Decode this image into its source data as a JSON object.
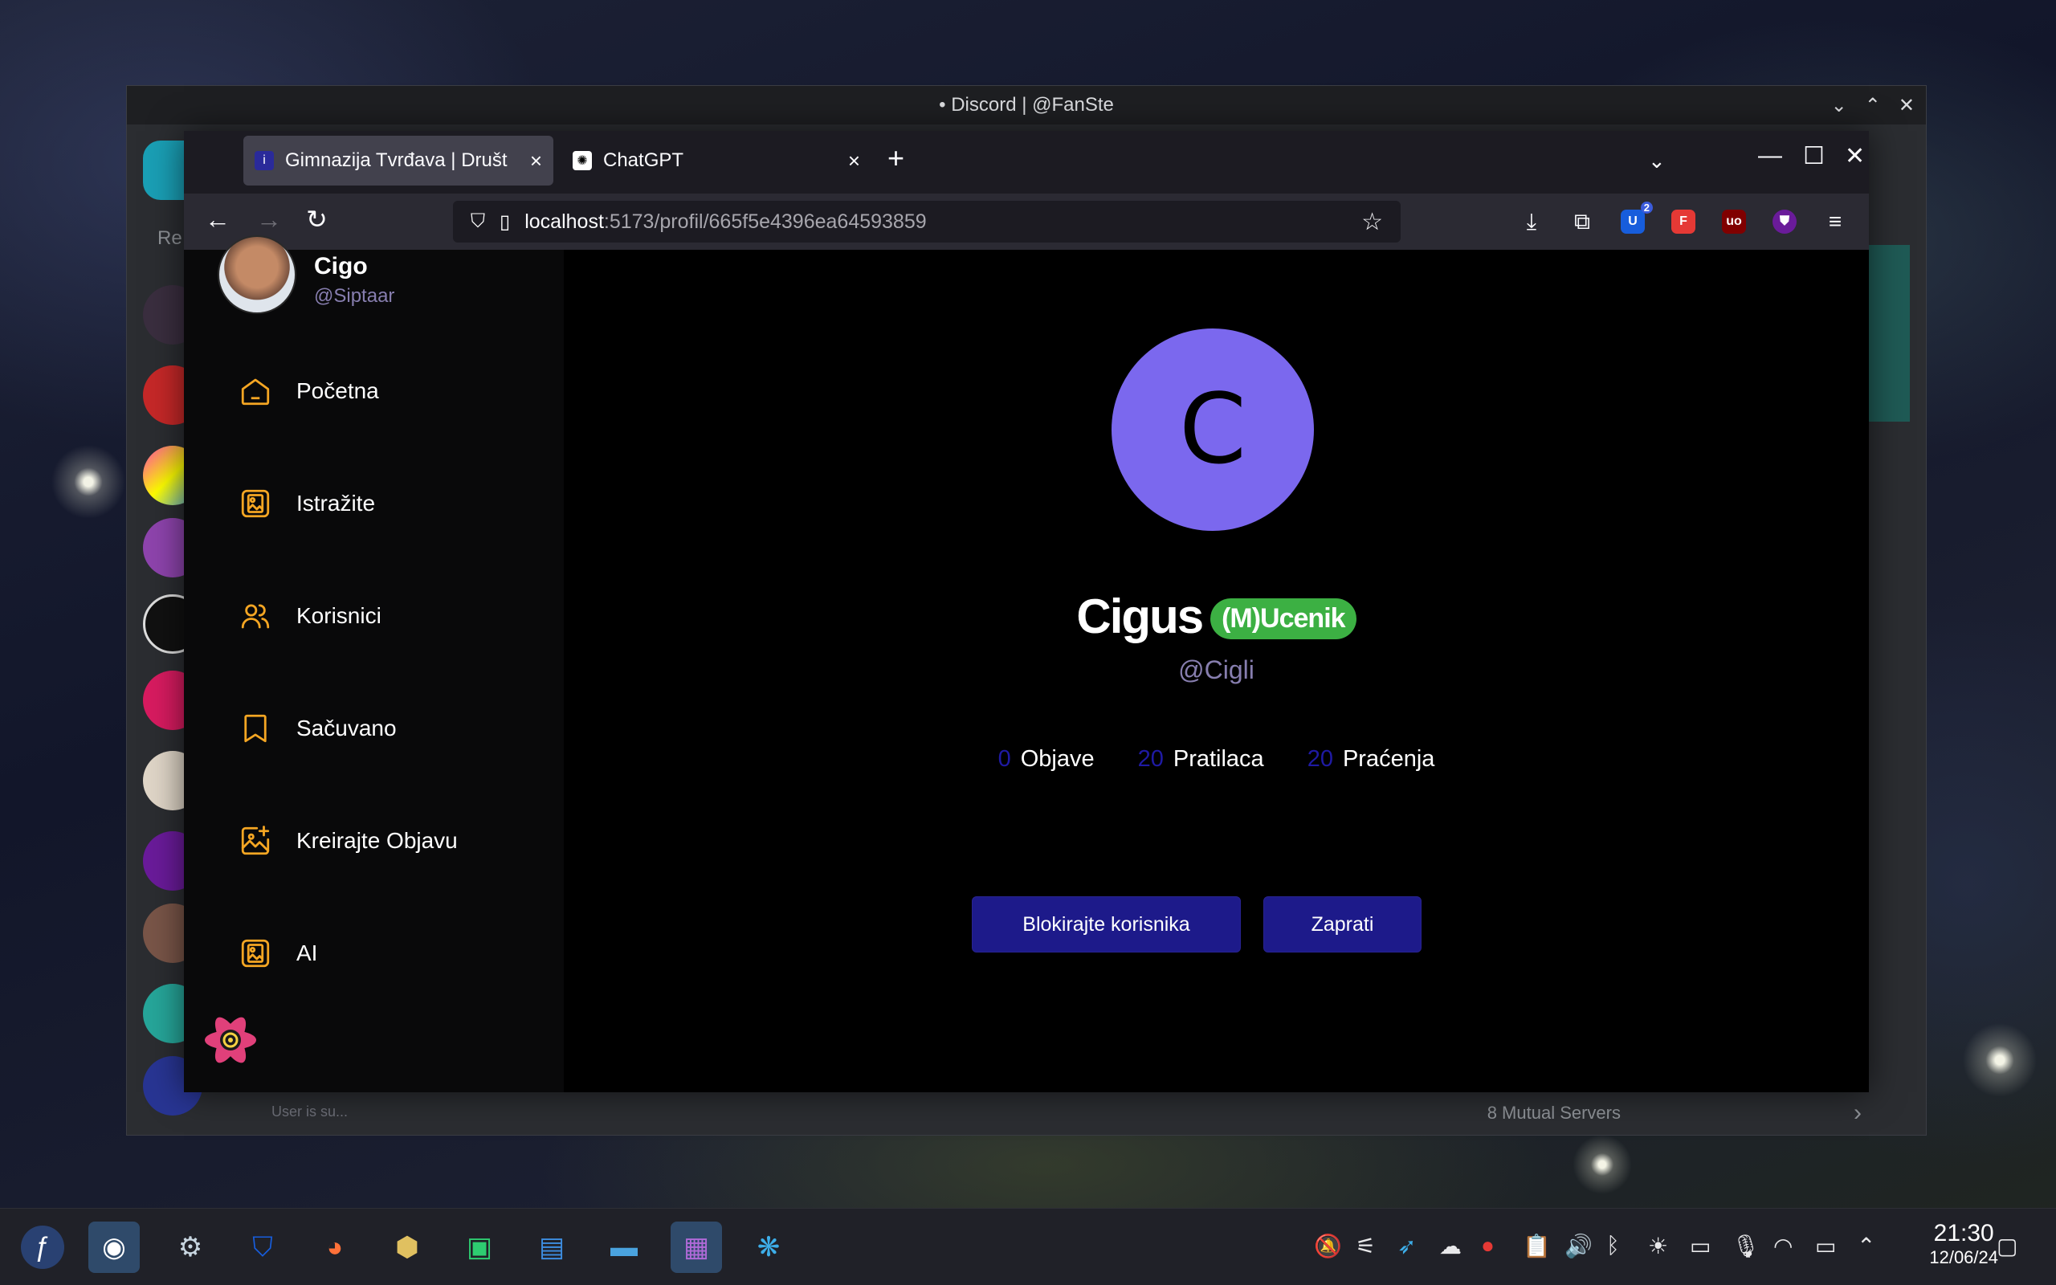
{
  "discord": {
    "title": "• Discord | @FanSte",
    "mutual_servers": "8 Mutual Servers",
    "user_status": "User is su...",
    "rail_label": "Re"
  },
  "browser": {
    "tabs": [
      {
        "title": "Gimnazija Tvrđava | Društ",
        "favicon": "i",
        "active": true
      },
      {
        "title": "ChatGPT",
        "favicon": "✺",
        "active": false
      }
    ],
    "url_host": "localhost",
    "url_rest": ":5173/profil/665f5e4396ea64593859",
    "ext_badge_count": "2"
  },
  "sidebar": {
    "user_name": "Cigo",
    "user_handle": "@Siptaar",
    "items": [
      {
        "label": "Početna",
        "icon": "home-icon"
      },
      {
        "label": "Istražite",
        "icon": "gallery-icon"
      },
      {
        "label": "Korisnici",
        "icon": "users-icon"
      },
      {
        "label": "Sačuvano",
        "icon": "bookmark-icon"
      },
      {
        "label": "Kreirajte Objavu",
        "icon": "image-add-icon"
      },
      {
        "label": "AI",
        "icon": "gallery-icon"
      }
    ]
  },
  "profile": {
    "initial": "C",
    "name": "Cigus",
    "role": "(M)Ucenik",
    "handle": "@Cigli",
    "stats": [
      {
        "value": "0",
        "label": "Objave"
      },
      {
        "value": "20",
        "label": "Pratilaca"
      },
      {
        "value": "20",
        "label": "Praćenja"
      }
    ],
    "block_button": "Blokirajte korisnika",
    "follow_button": "Zaprati"
  },
  "taskbar": {
    "time": "21:30",
    "date": "12/06/24"
  },
  "colors": {
    "accent": "#7b68ee",
    "icon_accent": "#f5a623",
    "button": "#1d1a8a",
    "role_badge": "#3cb043",
    "handle": "#877eaf"
  }
}
